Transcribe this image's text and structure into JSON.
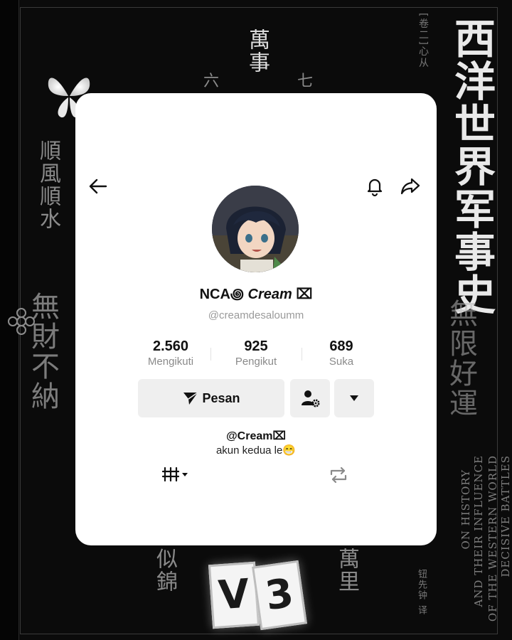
{
  "background": {
    "col_right_big": "西洋世界军事史",
    "col_right_overlay": "無限好運",
    "col_left_a": "順風順水",
    "col_left_b": "無財不納",
    "top_pair": "萬事",
    "bottom_pair_left": "似錦",
    "bottom_pair_right": "萬里",
    "small_nums": [
      "六",
      "七"
    ],
    "tag_vertical": "[卷二]心从",
    "english_lines": [
      "DECISIVE BATTLES",
      "OF THE WESTERN WORLD",
      "AND THEIR INFLUENCE",
      "ON HISTORY"
    ],
    "translator": "钮先钟 译",
    "v3_letters": [
      "V",
      "3"
    ]
  },
  "profile": {
    "name_prefix": "NCA꩜",
    "name_main": "Cream",
    "name_suffix": "⌧",
    "username": "@creamdesaloumm",
    "stats": [
      {
        "value": "2.560",
        "label": "Mengikuti"
      },
      {
        "value": "925",
        "label": "Pengikut"
      },
      {
        "value": "689",
        "label": "Suka"
      }
    ],
    "message_button": "Pesan",
    "bio_name": "@Cream⌧",
    "bio_text": "akun kedua le😁"
  },
  "icons": {
    "back": "back-arrow-icon",
    "bell": "bell-icon",
    "share": "share-icon",
    "send": "send-icon",
    "friend_settings": "user-gear-icon",
    "dropdown": "caret-down-icon",
    "grid_tab": "grid-menu-icon",
    "repost_tab": "repost-icon"
  },
  "colors": {
    "card": "#ffffff",
    "button": "#efefef",
    "muted": "#8a8a8a",
    "text": "#111111",
    "background": "#0b0b0b"
  }
}
